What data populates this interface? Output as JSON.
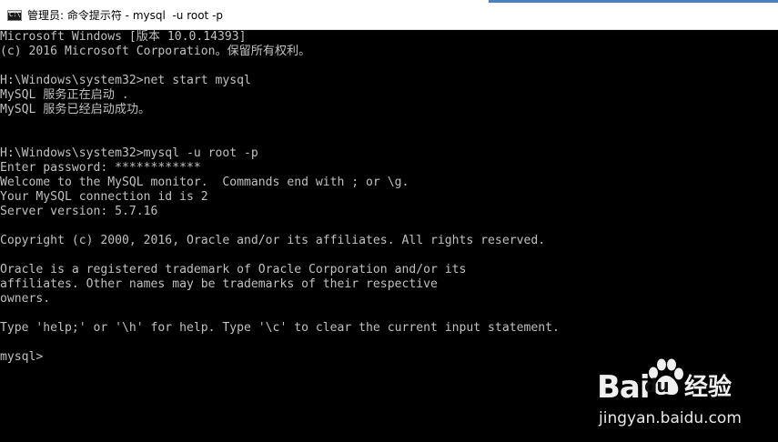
{
  "window": {
    "title": "管理员: 命令提示符 - mysql  -u root -p",
    "icon_name": "cmd-icon",
    "icon_text": "C:\\"
  },
  "console": {
    "lines": [
      "Microsoft Windows [版本 10.0.14393]",
      "(c) 2016 Microsoft Corporation。保留所有权利。",
      "",
      "H:\\Windows\\system32>net start mysql",
      "MySQL 服务正在启动 .",
      "MySQL 服务已经启动成功。",
      "",
      "",
      "H:\\Windows\\system32>mysql -u root -p",
      "Enter password: ************",
      "Welcome to the MySQL monitor.  Commands end with ; or \\g.",
      "Your MySQL connection id is 2",
      "Server version: 5.7.16",
      "",
      "Copyright (c) 2000, 2016, Oracle and/or its affiliates. All rights reserved.",
      "",
      "Oracle is a registered trademark of Oracle Corporation and/or its",
      "affiliates. Other names may be trademarks of their respective",
      "owners.",
      "",
      "Type 'help;' or '\\h' for help. Type '\\c' to clear the current input statement.",
      "",
      "mysql>"
    ]
  },
  "watermark": {
    "brand": "Bai",
    "brand_du": "du",
    "brand_cn": "经验",
    "url": "jingyan.baidu.com"
  },
  "colors": {
    "console_bg": "#000000",
    "console_fg": "#c0c0c0",
    "titlebar_bg": "#ffffff",
    "titlebar_accent": "#4a7fc0"
  }
}
